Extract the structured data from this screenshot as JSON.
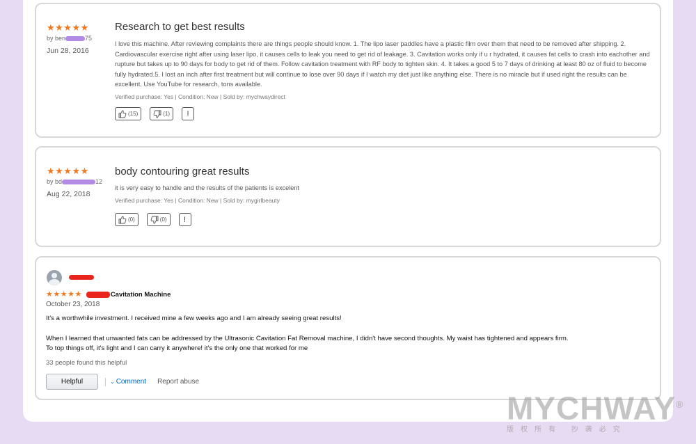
{
  "reviews": [
    {
      "stars": "★★★★★",
      "author_prefix": "by ben",
      "author_suffix": "75",
      "date": "Jun 28, 2016",
      "title": "Research to get best results",
      "text": "I love this machine. After reviewing complaints there are things people should know. 1. The lipo laser paddles have a plastic film over them that need to be removed after shipping. 2. Cardiovascular exercise right after using laser lipo, it causes cells to leak you need to get rid of leakage. 3. Cavitation works only if u r hydrated, it causes fat cells to crash into eachother and rupture but takes up to 90 days for body to get rid of them. Follow cavitation treatment with RF body to tighten skin. 4. It takes a good 5 to 7 days of drinking at least 80 oz of fluid to become fully hydrated.5. I lost an inch after first treatment but will continue to lose over 90 days if I watch my diet just like anything else. There is no miracle but if used right the results can be excellent. Use YouTube for research, tons available.",
      "verified": "Verified purchase: Yes | Condition: New | Sold by: mychwaydirect",
      "helpful_count": "(15)",
      "unhelpful_count": "(1)",
      "report_label": "!"
    },
    {
      "stars": "★★★★★",
      "author_prefix": "by bd",
      "author_suffix": "12",
      "date": "Aug 22, 2018",
      "title": "body contouring great results",
      "text": "it is very easy to handle and the results of the patients is excelent",
      "verified": "Verified purchase: Yes | Condition: New | Sold by: mygirlbeauty",
      "helpful_count": "(0)",
      "unhelpful_count": "(0)",
      "report_label": "!"
    }
  ],
  "review3": {
    "stars": "★★★★★",
    "title_suffix": "Cavitation Machine",
    "date": "October 23, 2018",
    "paragraph1": "It's a worthwhile investment. I received mine a few weeks ago and I am already seeing great results!",
    "paragraph2_line1": "When I learned that unwanted fats can be addressed by the Ultrasonic Cavitation Fat Removal machine, I didn't have second thoughts. My waist has tightened and appears firm.",
    "paragraph2_line2": "To top things off, it's light and I can carry it anywhere! it's the only one that worked for me",
    "helpful_text": "33 people found this helpful",
    "helpful_button": "Helpful",
    "comment_label": "Comment",
    "report_abuse": "Report abuse"
  },
  "watermark": {
    "brand": "MYCHWAY",
    "registered": "®",
    "subtitle": "版权所有 抄袭必究"
  },
  "colors": {
    "star": "#f0781e",
    "page_bg": "#e6dbf2",
    "redaction_purple": "#b38ae6",
    "redaction_red": "#e8241c",
    "link": "#0066c0"
  }
}
